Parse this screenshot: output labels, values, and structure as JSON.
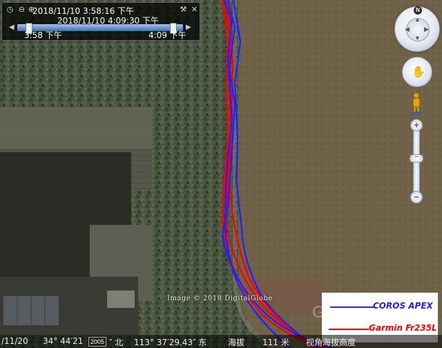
{
  "time_slider": {
    "start_datetime": "2018/11/10   3:58:16 下午",
    "end_datetime": "2018/11/10   4:09:30 下午",
    "start_label": "3:58 下午",
    "end_label": "4:09 下午",
    "position_start": 0.0,
    "position_end": 1.0
  },
  "navigation": {
    "north_label": "N",
    "zoom_in_label": "+",
    "zoom_out_label": "−",
    "zoom_knob_label": "−",
    "zoom_level": 0.45
  },
  "legend": {
    "entries": [
      {
        "label": "COROS APEX",
        "color": "#1f1fff"
      },
      {
        "label": "Garmin Fr235L",
        "color": "#ff0000"
      }
    ]
  },
  "imagery_credit": "Image © 2018 DigitalGlobe",
  "status_bar": {
    "date_fragment": "/11/20",
    "latitude": "34° 44′21",
    "imagery_year": "2005",
    "lat_direction": "″ 北",
    "longitude": "113° 37′29.43″ 东",
    "elevation_label": "海拔",
    "elevation_value": "111 米",
    "eye_alt_label": "视角海拔高度"
  },
  "colors": {
    "track_blue": "#1f1fff",
    "track_red": "#ff0000",
    "ground": "#6d6149",
    "trees": "#46503c",
    "building": "#3e3d35"
  }
}
